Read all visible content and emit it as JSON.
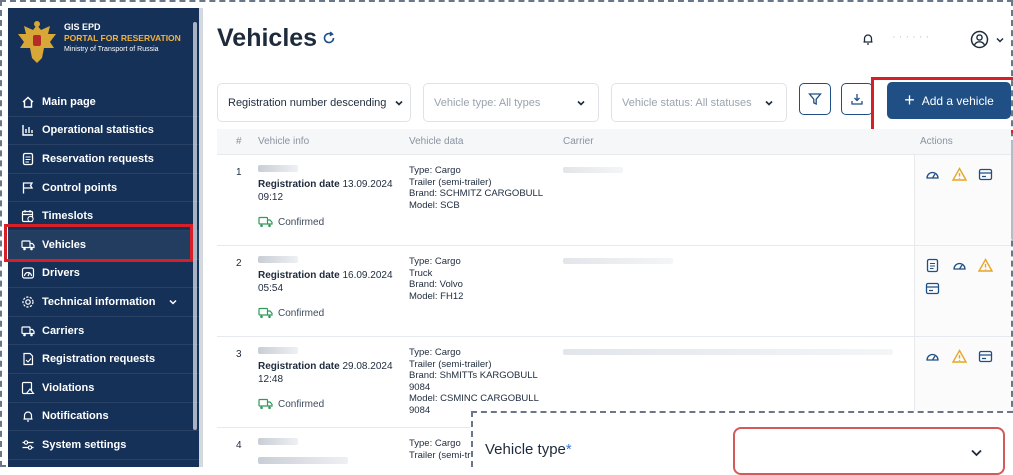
{
  "brand": {
    "title": "GIS EPD",
    "subtitle": "PORTAL FOR RESERVATION",
    "ministry": "Ministry of Transport of Russia"
  },
  "nav": {
    "items": [
      {
        "label": "Main page",
        "icon": "home-icon"
      },
      {
        "label": "Operational statistics",
        "icon": "bar-chart-icon"
      },
      {
        "label": "Reservation requests",
        "icon": "document-icon"
      },
      {
        "label": "Control points",
        "icon": "flag-icon"
      },
      {
        "label": "Timeslots",
        "icon": "calendar-clock-icon"
      },
      {
        "label": "Vehicles",
        "icon": "truck-icon"
      },
      {
        "label": "Drivers",
        "icon": "steering-icon"
      },
      {
        "label": "Technical information",
        "icon": "gear-icon"
      },
      {
        "label": "Carriers",
        "icon": "truck-icon"
      },
      {
        "label": "Registration requests",
        "icon": "document-icon"
      },
      {
        "label": "Violations",
        "icon": "violation-icon"
      },
      {
        "label": "Notifications",
        "icon": "bell-icon"
      },
      {
        "label": "System settings",
        "icon": "settings-sliders-icon"
      }
    ]
  },
  "page": {
    "title": "Vehicles",
    "user_name": "· · · · · ·"
  },
  "filters": {
    "sort": "Registration number descending",
    "vehicle_type_placeholder": "Vehicle type: All types",
    "vehicle_status_placeholder": "Vehicle status: All statuses"
  },
  "toolbar": {
    "add_label": "Add a vehicle"
  },
  "table": {
    "columns": [
      "#",
      "Vehicle info",
      "Vehicle data",
      "Carrier",
      "Actions"
    ],
    "rows": [
      {
        "num": "1",
        "reg_label": "Registration date",
        "reg_date": "13.09.2024",
        "reg_time": "09:12",
        "status": "Confirmed",
        "vdata": [
          "Type: Cargo",
          "Trailer (semi-trailer)",
          "Brand: SCHMITZ CARGOBULL",
          "Model: SCB"
        ]
      },
      {
        "num": "2",
        "reg_label": "Registration date",
        "reg_date": "16.09.2024",
        "reg_time": "05:54",
        "status": "Confirmed",
        "vdata": [
          "Type: Cargo",
          "Truck",
          "Brand: Volvo",
          "Model: FH12"
        ]
      },
      {
        "num": "3",
        "reg_label": "Registration date",
        "reg_date": "29.08.2024",
        "reg_time": "12:48",
        "status": "Confirmed",
        "vdata": [
          "Type: Cargo",
          "Trailer (semi-trailer)",
          "Brand: ShMITTs KARGOBULL",
          "9084",
          "Model: CSMINC CARGOBULL",
          "9084"
        ]
      },
      {
        "num": "4",
        "reg_label": "",
        "reg_date": "",
        "reg_time": "",
        "status": "",
        "vdata": [
          "Type: Cargo",
          "Trailer (semi-tr"
        ]
      }
    ]
  },
  "popup": {
    "label": "Vehicle type",
    "required_mark": "*"
  },
  "colors": {
    "sidebar": "#163158",
    "primary": "#1f4f84",
    "warning": "#e8a623",
    "highlight": "#d61f26"
  }
}
